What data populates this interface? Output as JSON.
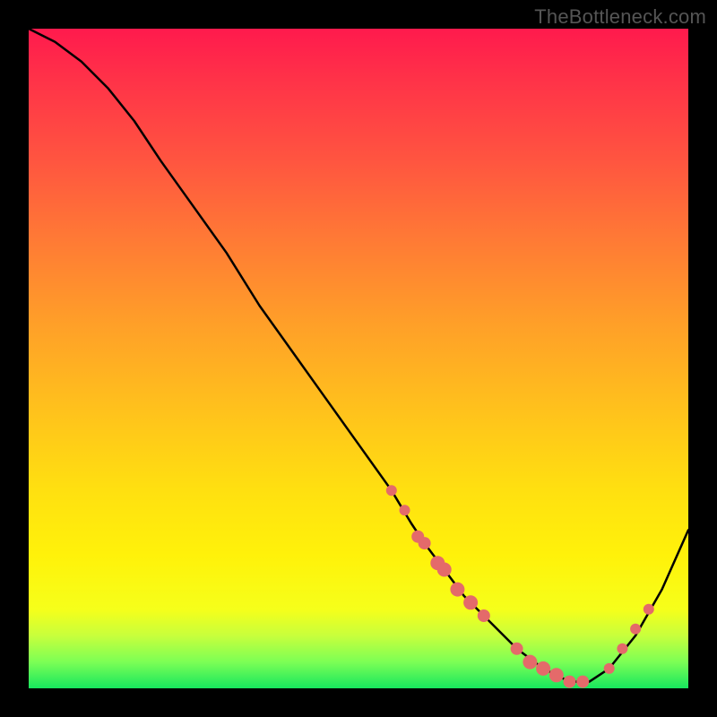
{
  "watermark": "TheBottleneck.com",
  "chart_data": {
    "type": "line",
    "title": "",
    "xlabel": "",
    "ylabel": "",
    "xlim": [
      0,
      100
    ],
    "ylim": [
      0,
      100
    ],
    "legend": false,
    "grid": false,
    "series": [
      {
        "name": "bottleneck-curve",
        "x": [
          0,
          4,
          8,
          12,
          16,
          20,
          25,
          30,
          35,
          40,
          45,
          50,
          55,
          58,
          60,
          63,
          66,
          70,
          74,
          78,
          82,
          85,
          88,
          92,
          96,
          100
        ],
        "y": [
          100,
          98,
          95,
          91,
          86,
          80,
          73,
          66,
          58,
          51,
          44,
          37,
          30,
          25,
          22,
          18,
          14,
          10,
          6,
          3,
          1,
          1,
          3,
          8,
          15,
          24
        ]
      }
    ],
    "markers": {
      "name": "highlight-points",
      "shape": "circle",
      "color": "#e46a6a",
      "points": [
        {
          "x": 55,
          "y": 30,
          "r": 6
        },
        {
          "x": 57,
          "y": 27,
          "r": 6
        },
        {
          "x": 59,
          "y": 23,
          "r": 7
        },
        {
          "x": 60,
          "y": 22,
          "r": 7
        },
        {
          "x": 62,
          "y": 19,
          "r": 8
        },
        {
          "x": 63,
          "y": 18,
          "r": 8
        },
        {
          "x": 65,
          "y": 15,
          "r": 8
        },
        {
          "x": 67,
          "y": 13,
          "r": 8
        },
        {
          "x": 69,
          "y": 11,
          "r": 7
        },
        {
          "x": 74,
          "y": 6,
          "r": 7
        },
        {
          "x": 76,
          "y": 4,
          "r": 8
        },
        {
          "x": 78,
          "y": 3,
          "r": 8
        },
        {
          "x": 80,
          "y": 2,
          "r": 8
        },
        {
          "x": 82,
          "y": 1,
          "r": 7
        },
        {
          "x": 84,
          "y": 1,
          "r": 7
        },
        {
          "x": 88,
          "y": 3,
          "r": 6
        },
        {
          "x": 90,
          "y": 6,
          "r": 6
        },
        {
          "x": 92,
          "y": 9,
          "r": 6
        },
        {
          "x": 94,
          "y": 12,
          "r": 6
        }
      ]
    },
    "annotations": []
  }
}
